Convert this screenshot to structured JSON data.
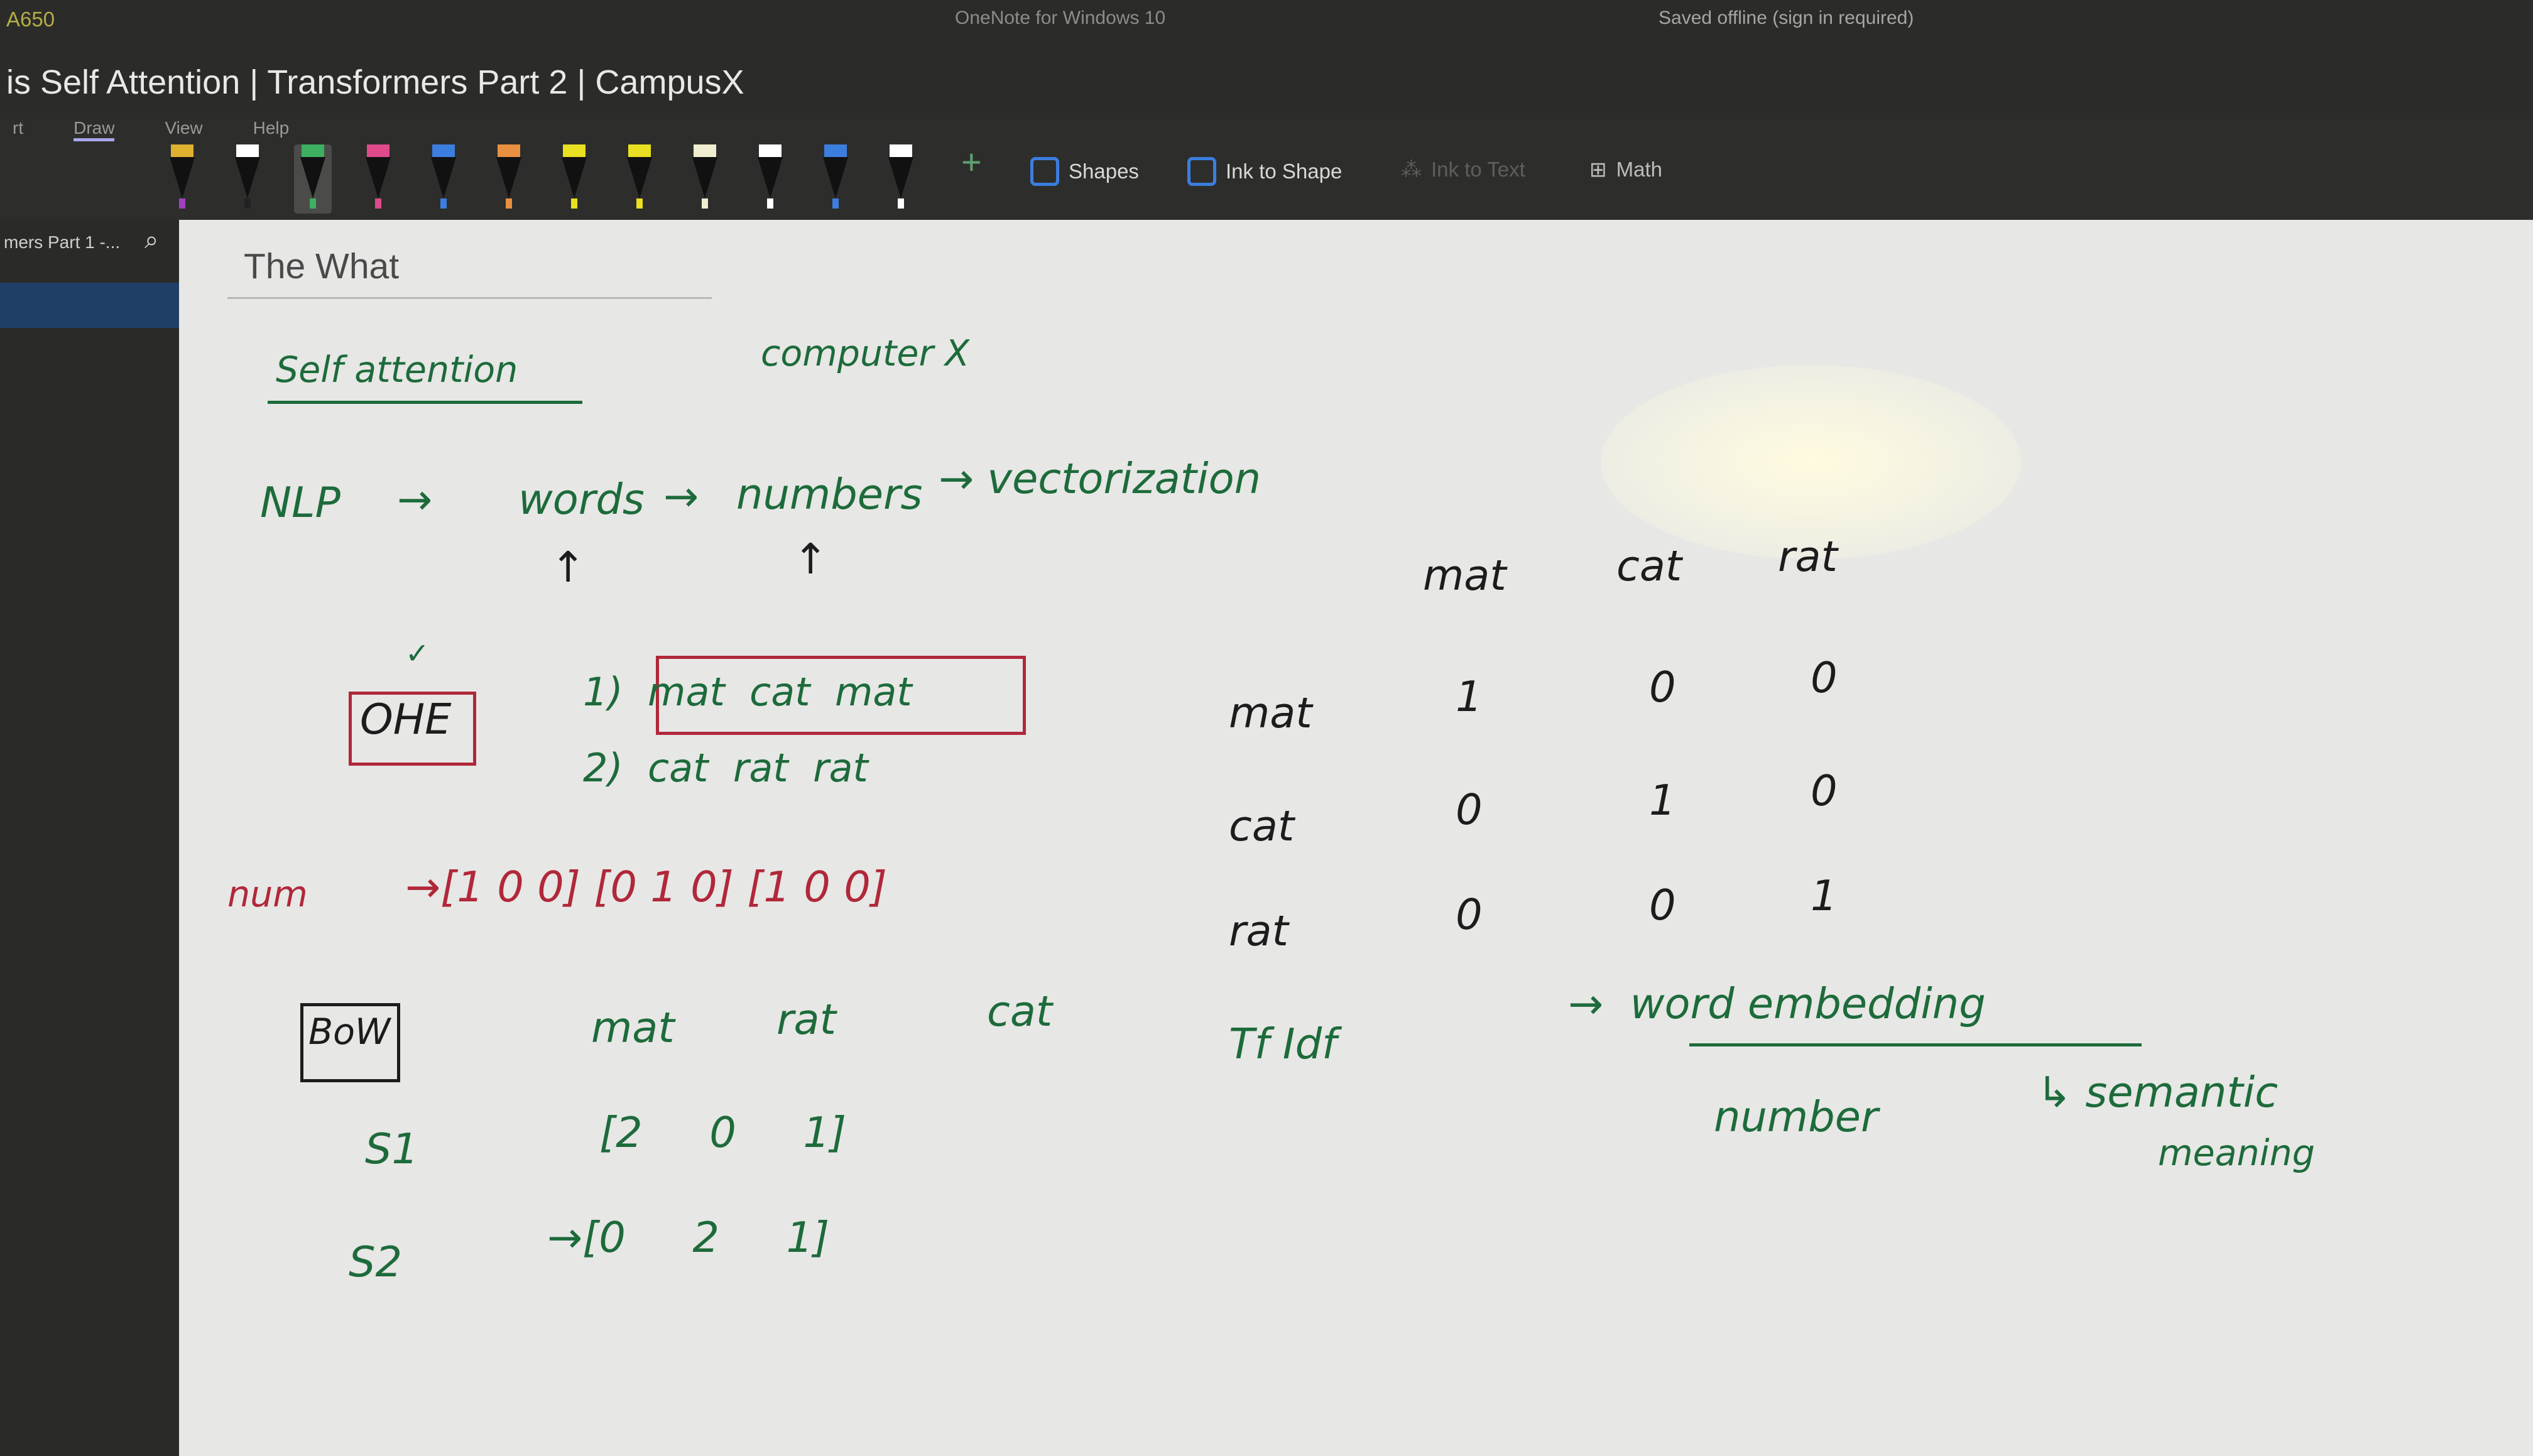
{
  "window": {
    "corner_code": "A650",
    "app_name": "OneNote for Windows 10",
    "doc_title": "is Self Attention | Transformers Part 2 | CampusX",
    "save_status": "Saved offline (sign in required)"
  },
  "ribbon": {
    "tabs": [
      {
        "label": "rt"
      },
      {
        "label": "Draw",
        "active": true
      },
      {
        "label": "View"
      },
      {
        "label": "Help"
      }
    ],
    "pens": [
      {
        "cap": "#e0b030",
        "body": "#a040c0"
      },
      {
        "cap": "#ffffff",
        "body": "#222"
      },
      {
        "cap": "#3cb060",
        "body": "#3cb060",
        "selected": true
      },
      {
        "cap": "#e04a8a",
        "body": "#e04a8a"
      },
      {
        "cap": "#3c7ee0",
        "body": "#3c7ee0"
      },
      {
        "cap": "#e89040",
        "body": "#e89040"
      },
      {
        "cap": "#e8e020",
        "body": "#e8e020"
      },
      {
        "cap": "#e8e020",
        "body": "#e8e020"
      },
      {
        "cap": "#f0eed0",
        "body": "#f0eed0"
      },
      {
        "cap": "#ffffff",
        "body": "#ffffff"
      },
      {
        "cap": "#3c7ee0",
        "body": "#3c7ee0"
      },
      {
        "cap": "#ffffff",
        "body": "#ffffff"
      }
    ],
    "add_pen": "+",
    "shapes_label": "Shapes",
    "ink_to_shape_label": "Ink to Shape",
    "ink_to_text_label": "Ink to Text",
    "math_label": "Math"
  },
  "sidebar": {
    "section_label": "mers Part 1 -...",
    "search_icon": "⌕"
  },
  "page": {
    "title": "The What",
    "ink": {
      "self_attention": "Self attention",
      "computer": "computer X",
      "nlp": "NLP",
      "arrow": "→",
      "words": "words",
      "numbers": "numbers",
      "vectorization": "→ vectorization",
      "up_arrow": "↑",
      "ohe": "OHE",
      "check": "✓",
      "doc1": "1)  mat  cat  mat",
      "doc2": "2)  cat  rat  rat",
      "num_label": "num",
      "num_vectors": "→[1 0 0] [0 1 0] [1 0 0]",
      "matrix_headers": [
        "mat",
        "cat",
        "rat"
      ],
      "matrix_rows": [
        {
          "label": "mat",
          "values": [
            "1",
            "0",
            "0"
          ]
        },
        {
          "label": "cat",
          "values": [
            "0",
            "1",
            "0"
          ]
        },
        {
          "label": "rat",
          "values": [
            "0",
            "0",
            "1"
          ]
        }
      ],
      "bow": "BoW",
      "bow_headers": [
        "mat",
        "rat",
        "cat"
      ],
      "s1": "S1",
      "s1_vec": "[2     0     1]",
      "s2": "S2",
      "s2_vec": "→[0     2     1]",
      "tfidf": "Tf Idf",
      "word_embedding": "→  word embedding",
      "number": "number",
      "semantic": "↳ semantic",
      "meaning": "meaning"
    },
    "ink_colors": {
      "green": "#1d6b3b",
      "black": "#1c1c1c",
      "red": "#b0283a"
    }
  }
}
